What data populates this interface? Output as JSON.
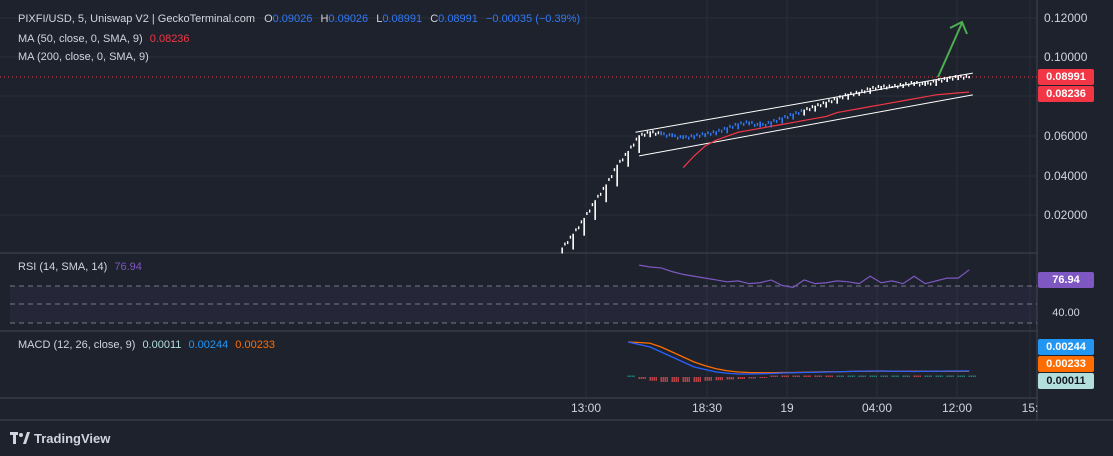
{
  "header": {
    "symbol": "PIXFI/USD, 5, Uniswap V2 | GeckoTerminal.com",
    "o_label": "O",
    "o_value": "0.09026",
    "h_label": "H",
    "h_value": "0.09026",
    "l_label": "L",
    "l_value": "0.08991",
    "c_label": "C",
    "c_value": "0.08991",
    "change": "−0.00035 (−0.39%)"
  },
  "indicators": {
    "ma50_label": "MA (50, close, 0, SMA, 9)",
    "ma50_value": "0.08236",
    "ma200_label": "MA (200, close, 0, SMA, 9)",
    "rsi_label": "RSI (14, SMA, 14)",
    "rsi_value": "76.94",
    "macd_label": "MACD (12, 26, close, 9)",
    "macd_hist": "0.00011",
    "macd_line": "0.00244",
    "macd_signal": "0.00233"
  },
  "price_tags": {
    "last": "0.08991",
    "ma50": "0.08236",
    "rsi": "76.94",
    "rsi_level": "40.00",
    "macd_line": "0.00244",
    "macd_signal": "0.00233",
    "macd_hist": "0.00011"
  },
  "colors": {
    "background": "#1e222d",
    "candle": "#ffffff",
    "candle_dim": "#3179f5",
    "ma50": "#f23645",
    "rsi": "#7e57c2",
    "macd_line": "#2962ff",
    "macd_signal": "#ff6d00",
    "hist_neg": "#ff5252",
    "hist_pos": "#26a69a",
    "arrow": "#4caf50",
    "channel": "#ffffff"
  },
  "footer": {
    "brand": "TradingView"
  },
  "chart_data": {
    "type": "line",
    "title": "PIXFI/USD, 5, Uniswap V2 | GeckoTerminal.com",
    "price_axis": [
      "0.12000",
      "0.10000",
      "0.06000",
      "0.04000",
      "0.02000"
    ],
    "time_axis": [
      "13:00",
      "18:30",
      "19",
      "04:00",
      "12:00",
      "15:"
    ],
    "ylim": [
      0,
      0.12
    ],
    "price": {
      "name": "PIXFI/USD",
      "x": [
        "11:55",
        "12:25",
        "12:55",
        "13:25",
        "13:55",
        "14:25",
        "14:55",
        "15:25",
        "15:55",
        "16:25",
        "16:55",
        "17:25",
        "17:55",
        "18:25",
        "18:55",
        "19:25",
        "19:55",
        "20:25",
        "20:55",
        "21:25",
        "21:55",
        "22:25",
        "22:55",
        "23:25",
        "23:55",
        "00:25",
        "00:55",
        "01:25",
        "01:55",
        "02:25",
        "02:55",
        "03:25",
        "03:55",
        "04:25",
        "04:55",
        "05:25",
        "05:55",
        "06:25"
      ],
      "values": [
        0.003,
        0.01,
        0.018,
        0.027,
        0.035,
        0.045,
        0.052,
        0.06,
        0.062,
        0.061,
        0.06,
        0.059,
        0.06,
        0.061,
        0.062,
        0.064,
        0.066,
        0.067,
        0.065,
        0.067,
        0.069,
        0.071,
        0.073,
        0.075,
        0.077,
        0.079,
        0.081,
        0.082,
        0.084,
        0.085,
        0.085,
        0.086,
        0.087,
        0.086,
        0.088,
        0.089,
        0.09,
        0.0899
      ]
    },
    "ma50": {
      "values": [
        null,
        null,
        null,
        null,
        null,
        null,
        null,
        null,
        null,
        null,
        null,
        0.044,
        0.05,
        0.055,
        0.058,
        0.06,
        0.062,
        0.063,
        0.064,
        0.065,
        0.066,
        0.067,
        0.068,
        0.069,
        0.07,
        0.072,
        0.073,
        0.074,
        0.075,
        0.076,
        0.077,
        0.078,
        0.079,
        0.08,
        0.081,
        0.0815,
        0.082,
        0.0824
      ]
    },
    "channel_upper": {
      "x": [
        "15:15",
        "06:35"
      ],
      "values": [
        0.062,
        0.092
      ]
    },
    "channel_lower": {
      "x": [
        "15:25",
        "06:35"
      ],
      "values": [
        0.05,
        0.081
      ]
    },
    "rsi": {
      "values": [
        null,
        null,
        null,
        null,
        null,
        null,
        null,
        82,
        80,
        79,
        75,
        72,
        70,
        68,
        66,
        64,
        65,
        62,
        63,
        66,
        60,
        58,
        66,
        62,
        63,
        65,
        64,
        62,
        70,
        63,
        65,
        62,
        70,
        62,
        65,
        68,
        68,
        76.94
      ]
    },
    "macd": {
      "line": [
        null,
        null,
        null,
        null,
        null,
        null,
        0.014,
        0.013,
        0.012,
        0.01,
        0.008,
        0.006,
        0.004,
        0.003,
        0.002,
        0.0015,
        0.0012,
        0.0012,
        0.0013,
        0.0014,
        0.0016,
        0.0017,
        0.0018,
        0.0019,
        0.002,
        0.0021,
        0.0022,
        0.0023,
        0.0024,
        0.0024,
        0.0023,
        0.0023,
        0.0022,
        0.0023,
        0.0023,
        0.0024,
        0.0024,
        0.00244
      ],
      "signal": [
        null,
        null,
        null,
        null,
        null,
        null,
        0.014,
        0.0138,
        0.0135,
        0.012,
        0.01,
        0.008,
        0.006,
        0.0045,
        0.0033,
        0.0025,
        0.002,
        0.0018,
        0.0017,
        0.0017,
        0.0018,
        0.0018,
        0.0019,
        0.002,
        0.0021,
        0.0021,
        0.0022,
        0.0023,
        0.0023,
        0.0024,
        0.0023,
        0.0023,
        0.0023,
        0.0023,
        0.0023,
        0.0023,
        0.0023,
        0.00233
      ],
      "ylim": [
        -0.002,
        0.016
      ]
    }
  }
}
